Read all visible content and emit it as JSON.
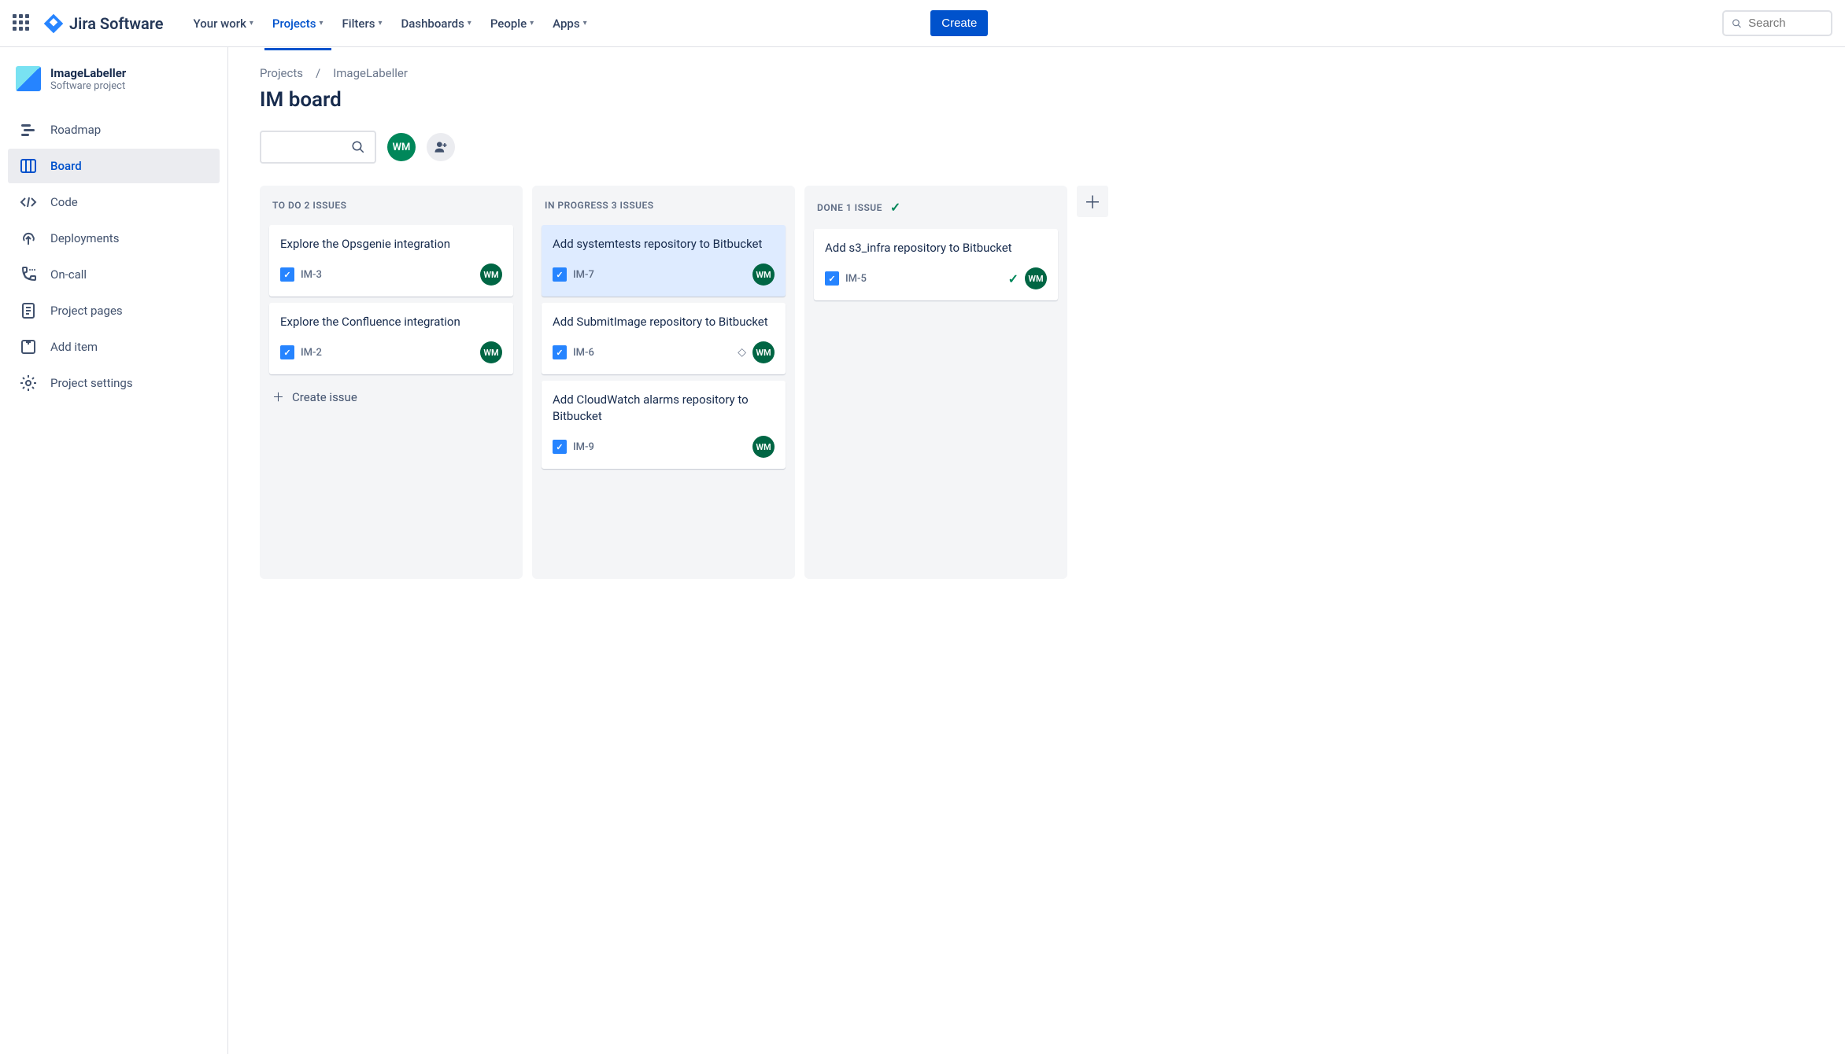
{
  "topnav": {
    "logo_text": "Jira Software",
    "items": [
      "Your work",
      "Projects",
      "Filters",
      "Dashboards",
      "People",
      "Apps"
    ],
    "active_index": 1,
    "create_label": "Create",
    "search_placeholder": "Search"
  },
  "sidebar": {
    "project_name": "ImageLabeller",
    "project_type": "Software project",
    "items": [
      {
        "label": "Roadmap",
        "icon": "roadmap"
      },
      {
        "label": "Board",
        "icon": "board",
        "active": true
      },
      {
        "label": "Code",
        "icon": "code"
      },
      {
        "label": "Deployments",
        "icon": "deployments"
      },
      {
        "label": "On-call",
        "icon": "oncall"
      },
      {
        "label": "Project pages",
        "icon": "page"
      },
      {
        "label": "Add item",
        "icon": "add"
      },
      {
        "label": "Project settings",
        "icon": "settings"
      }
    ]
  },
  "breadcrumb": {
    "root": "Projects",
    "current": "ImageLabeller"
  },
  "page_title": "IM board",
  "avatar_initials": "WM",
  "columns": [
    {
      "title": "To Do",
      "count_label": "2 issues",
      "done": false,
      "cards": [
        {
          "title": "Explore the Opsgenie integration",
          "key": "IM-3",
          "assignee": "WM"
        },
        {
          "title": "Explore the Confluence integration",
          "key": "IM-2",
          "assignee": "WM"
        }
      ],
      "show_create": true
    },
    {
      "title": "In Progress",
      "count_label": "3 issues",
      "done": false,
      "cards": [
        {
          "title": "Add systemtests repository to Bitbucket",
          "key": "IM-7",
          "assignee": "WM",
          "highlight": true
        },
        {
          "title": "Add SubmitImage repository to Bitbucket",
          "key": "IM-6",
          "assignee": "WM",
          "priority": true
        },
        {
          "title": "Add CloudWatch alarms repository to Bitbucket",
          "key": "IM-9",
          "assignee": "WM"
        }
      ]
    },
    {
      "title": "Done",
      "count_label": "1 issue",
      "done": true,
      "cards": [
        {
          "title": "Add s3_infra repository to Bitbucket",
          "key": "IM-5",
          "assignee": "WM",
          "done": true
        }
      ]
    }
  ],
  "create_issue_label": "Create issue"
}
